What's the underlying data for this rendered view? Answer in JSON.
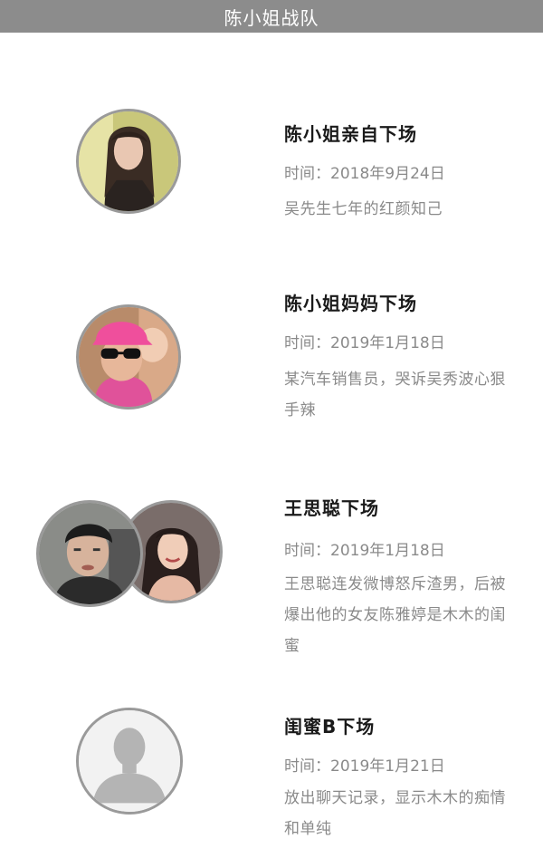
{
  "header": {
    "title": "陈小姐战队"
  },
  "entries": [
    {
      "title": "陈小姐亲自下场",
      "date": "时间：2018年9月24日",
      "desc": "吴先生七年的红颜知己",
      "avatar": "woman-portrait-photo"
    },
    {
      "title": "陈小姐妈妈下场",
      "date": "时间：2019年1月18日",
      "desc": "某汽车销售员，哭诉吴秀波心狠手辣",
      "avatar": "woman-pink-cap-sunglasses-photo"
    },
    {
      "title": "王思聪下场",
      "date": "时间：2019年1月18日",
      "desc": "王思聪连发微博怒斥渣男，后被爆出他的女友陈雅婷是木木的闺蜜",
      "avatar": [
        "man-portrait-photo",
        "woman-smiling-photo"
      ]
    },
    {
      "title": "闺蜜B下场",
      "date": "时间：2019年1月21日",
      "desc": "放出聊天记录，显示木木的痴情和单纯",
      "avatar": "default-user-silhouette-icon"
    }
  ]
}
